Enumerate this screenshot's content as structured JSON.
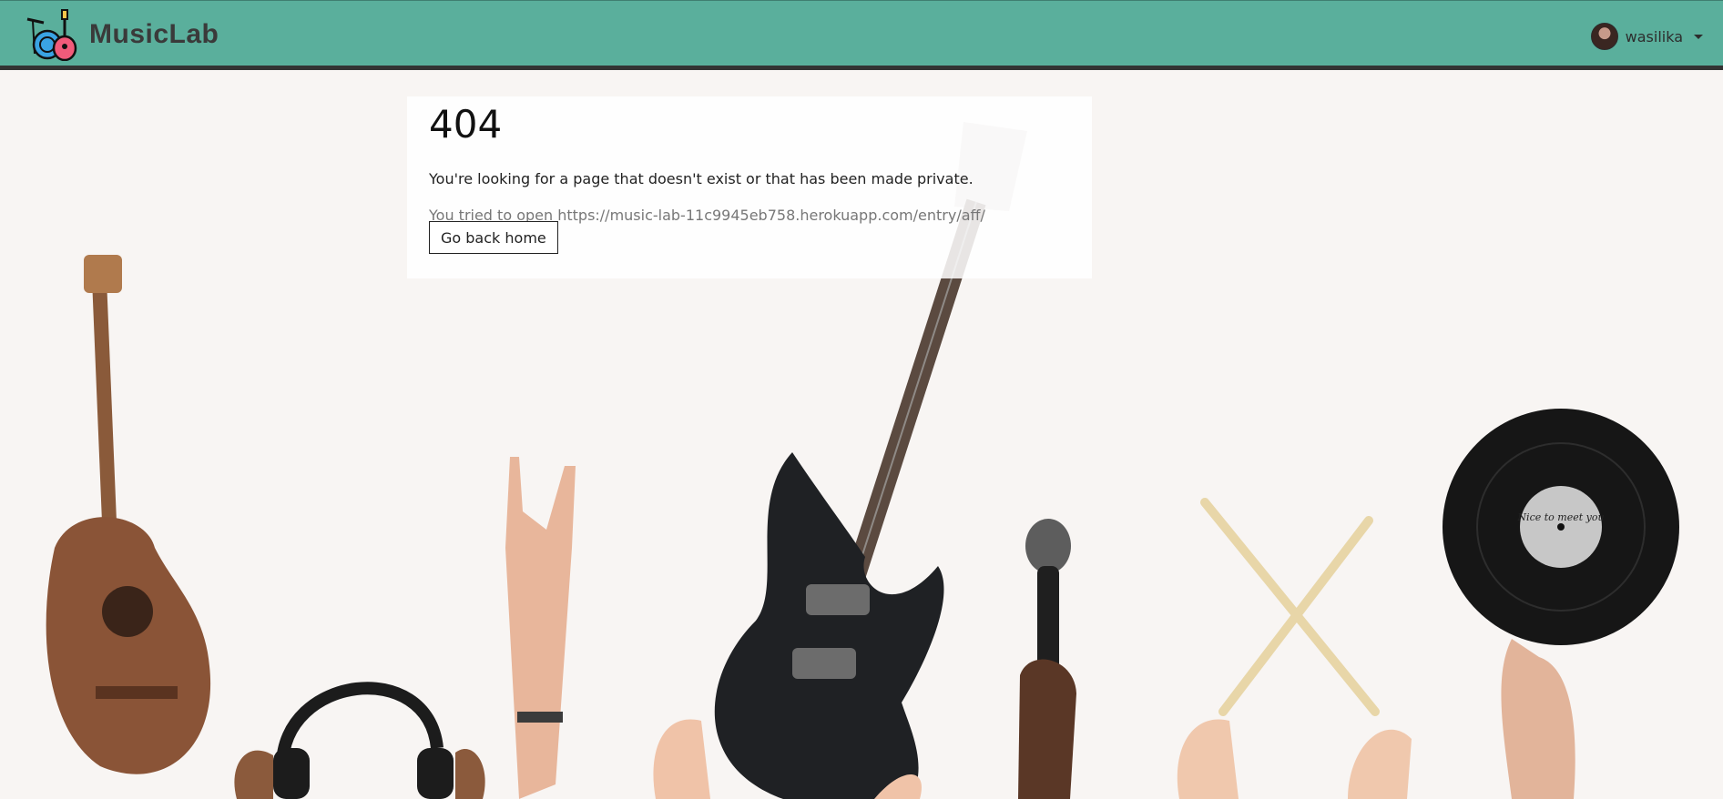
{
  "brand": {
    "name": "MusicLab"
  },
  "user": {
    "name": "wasilika"
  },
  "error": {
    "code": "404",
    "message": "You're looking for a page that doesn't exist or that has been made private.",
    "tried_prefix": "You tried to open",
    "tried_url": "https://music-lab-11c9945eb758.herokuapp.com/entry/aff/",
    "home_button": "Go back home"
  },
  "record_label": "Nice to meet you",
  "icons": {
    "logo": "drums-guitar-logo",
    "avatar": "avatar",
    "caret": "chevron-down-icon"
  },
  "colors": {
    "navbar": "#5aaf9c",
    "navbar_border": "#333333",
    "background": "#f8f5f3"
  }
}
